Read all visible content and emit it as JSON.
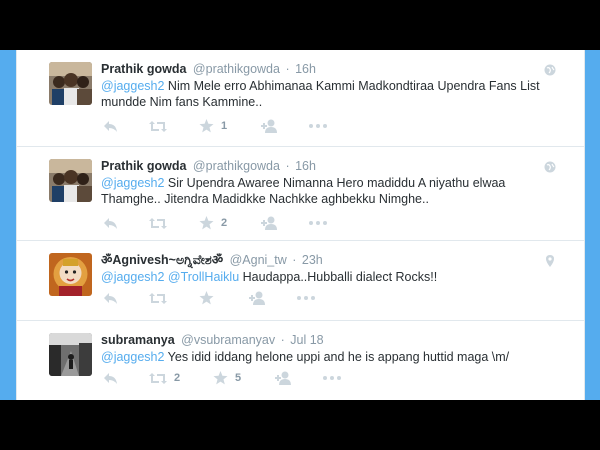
{
  "colors": {
    "accent": "#55acee",
    "icon_gray": "#ccd6dd",
    "text": "#292f33",
    "meta": "#8899a6"
  },
  "tweets": [
    {
      "fullname": "Prathik gowda",
      "username": "@prathikgowda",
      "time": "16h",
      "mention": "@jaggesh2",
      "text": " Nim Mele erro Abhimanaa Kammi Madkondtiraa Upendra Fans List mundde Nim fans Kammine..",
      "retweets": "",
      "favorites": "1",
      "avatar": "group-photo",
      "corner_icon": "globe-icon"
    },
    {
      "fullname": "Prathik gowda",
      "username": "@prathikgowda",
      "time": "16h",
      "mention": "@jaggesh2",
      "text": " Sir Upendra Awaree Nimanna Hero madiddu A niyathu elwaa Thamghe.. Jitendra Madidkke Nachkke aghbekku Nimghe..",
      "retweets": "",
      "favorites": "2",
      "avatar": "group-photo",
      "corner_icon": "globe-icon"
    },
    {
      "fullname": "ॐAgnivesh~ಅಗ್ನಿವೇಶॐ",
      "username": "@Agni_tw",
      "time": "23h",
      "mention": "@jaggesh2 @TrollHaiklu",
      "text": " Haudappa..Hubballi dialect Rocks!!",
      "retweets": "",
      "favorites": "",
      "avatar": "deity-portrait",
      "corner_icon": "location-pin-icon"
    },
    {
      "fullname": "subramanya",
      "username": "@vsubramanyav",
      "time": "Jul 18",
      "mention": "@jaggesh2",
      "text": " Yes idid iddang helone uppi and he is appang huttid maga \\m/",
      "retweets": "2",
      "favorites": "5",
      "avatar": "bw-street-photo",
      "corner_icon": ""
    }
  ]
}
